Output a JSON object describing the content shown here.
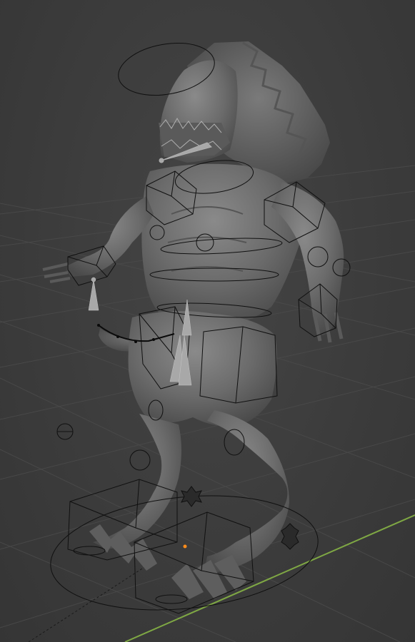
{
  "viewport": {
    "background_color": "#3d3d3d",
    "grid_color": "#4a4a4a",
    "axis_x_color": "#7fa844",
    "model_color": "#6e6e6e",
    "rig_line_color": "#101010",
    "selected_bone_color": "#a8a8a8",
    "origin_color": "#ff8c1a"
  },
  "objects": [
    {
      "name": "creature-mesh",
      "kind": "sculpted-mesh",
      "view": "solid"
    },
    {
      "name": "armature",
      "kind": "bone-rig",
      "display": "wire-custom-shapes"
    }
  ],
  "icons": [
    "3d-cursor-icon",
    "object-origin-icon",
    "custom-bone-shape-icon"
  ]
}
